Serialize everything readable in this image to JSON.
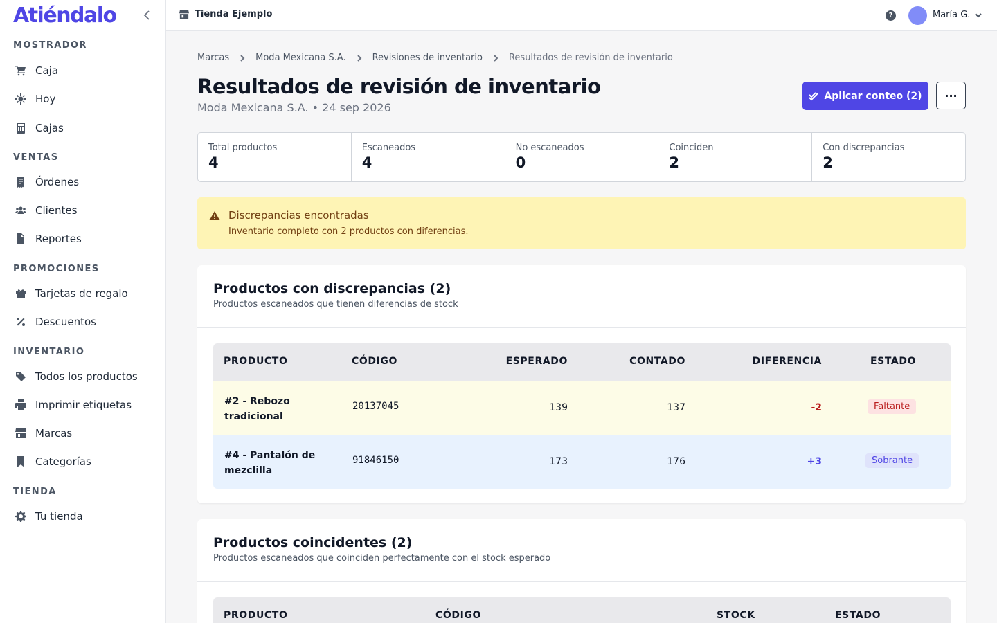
{
  "brand": "Atiéndalo",
  "sidebar": {
    "sections": [
      {
        "title": "MOSTRADOR"
      },
      {
        "title": "VENTAS"
      },
      {
        "title": "PROMOCIONES"
      },
      {
        "title": "INVENTARIO"
      },
      {
        "title": "TIENDA"
      }
    ],
    "items": [
      {
        "label": "Caja",
        "icon": "cart-icon"
      },
      {
        "label": "Hoy",
        "icon": "sun-icon"
      },
      {
        "label": "Cajas",
        "icon": "calculator-icon"
      },
      {
        "label": "Órdenes",
        "icon": "receipt-icon"
      },
      {
        "label": "Clientes",
        "icon": "users-icon"
      },
      {
        "label": "Reportes",
        "icon": "file-icon"
      },
      {
        "label": "Tarjetas de regalo",
        "icon": "gift-icon"
      },
      {
        "label": "Descuentos",
        "icon": "percent-icon"
      },
      {
        "label": "Todos los productos",
        "icon": "tag-icon"
      },
      {
        "label": "Imprimir etiquetas",
        "icon": "printer-icon"
      },
      {
        "label": "Marcas",
        "icon": "store-icon"
      },
      {
        "label": "Categorías",
        "icon": "bookmark-icon"
      },
      {
        "label": "Tu tienda",
        "icon": "gear-icon"
      }
    ]
  },
  "topbar": {
    "store": "Tienda Ejemplo",
    "help": "?",
    "user": "María G."
  },
  "breadcrumbs": [
    "Marcas",
    "Moda Mexicana S.A.",
    "Revisiones de inventario",
    "Resultados de revisión de inventario"
  ],
  "page": {
    "title": "Resultados de revisión de inventario",
    "subtitle": "Moda Mexicana S.A. • 24 sep 2026",
    "apply_button": "Aplicar conteo (2)",
    "more_button": "···"
  },
  "stats": [
    {
      "label": "Total productos",
      "value": "4"
    },
    {
      "label": "Escaneados",
      "value": "4"
    },
    {
      "label": "No escaneados",
      "value": "0"
    },
    {
      "label": "Coinciden",
      "value": "2"
    },
    {
      "label": "Con discrepancias",
      "value": "2"
    }
  ],
  "alert": {
    "title": "Discrepancias encontradas",
    "body": "Inventario completo con 2 productos con diferencias."
  },
  "discrepancies": {
    "title": "Productos con discrepancias (2)",
    "subtitle": "Productos escaneados que tienen diferencias de stock",
    "columns": [
      "PRODUCTO",
      "CÓDIGO",
      "ESPERADO",
      "CONTADO",
      "DIFERENCIA",
      "ESTADO"
    ],
    "rows": [
      {
        "name": "#2 - Rebozo tradicional",
        "code": "20137045",
        "expected": "139",
        "counted": "137",
        "diff": "-2",
        "status": "Faltante"
      },
      {
        "name": "#4 - Pantalón de mezclilla",
        "code": "91846150",
        "expected": "173",
        "counted": "176",
        "diff": "+3",
        "status": "Sobrante"
      }
    ]
  },
  "matches": {
    "title": "Productos coincidentes (2)",
    "subtitle": "Productos escaneados que coinciden perfectamente con el stock esperado",
    "columns": [
      "PRODUCTO",
      "CÓDIGO",
      "STOCK",
      "ESTADO"
    ]
  },
  "colors": {
    "accent": "#4f46e5",
    "alert_bg": "#fef4b5",
    "shortage_row": "#fdfce7",
    "surplus_row": "#e8f2fe",
    "shortage_text": "#b91c1c",
    "surplus_text": "#4f46e5"
  }
}
